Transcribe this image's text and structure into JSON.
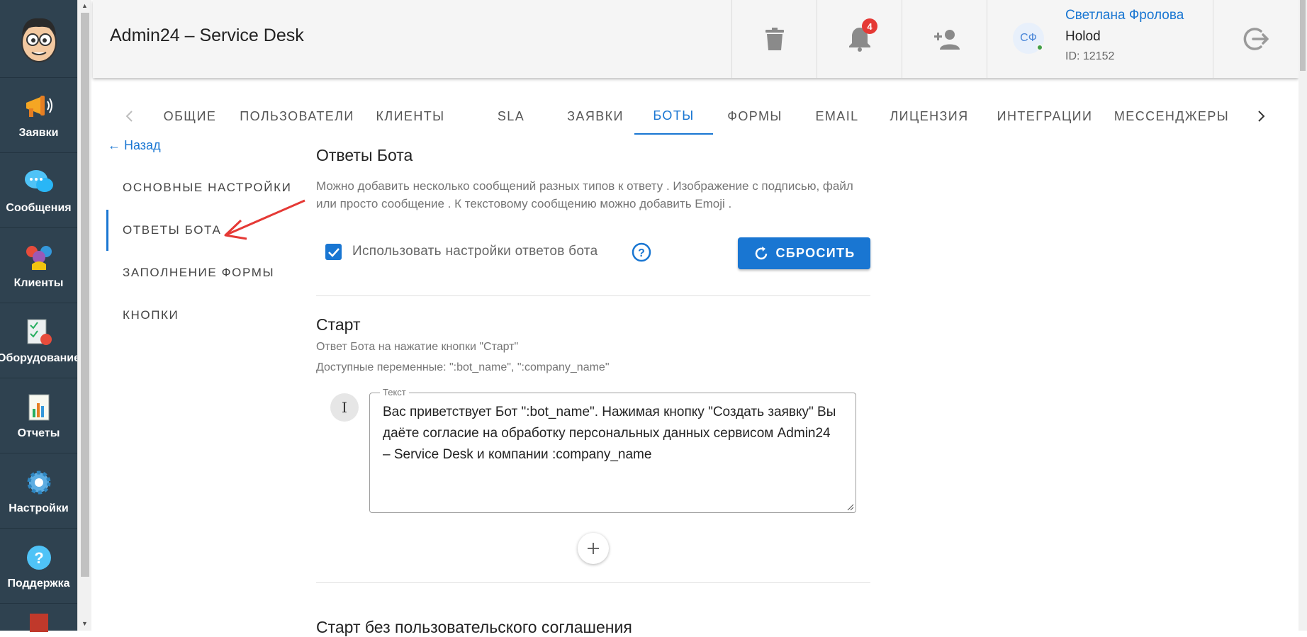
{
  "app": {
    "title": "Admin24 – Service Desk"
  },
  "sidebar": {
    "items": [
      {
        "label": "Заявки",
        "icon": "megaphone-icon"
      },
      {
        "label": "Сообщения",
        "icon": "chat-bubbles-icon"
      },
      {
        "label": "Клиенты",
        "icon": "people-icon"
      },
      {
        "label": "Оборудование",
        "icon": "equipment-checklist-icon"
      },
      {
        "label": "Отчеты",
        "icon": "report-chart-icon"
      },
      {
        "label": "Настройки",
        "icon": "gear-icon"
      },
      {
        "label": "Поддержка",
        "icon": "question-icon"
      }
    ]
  },
  "header": {
    "notifications_count": "4",
    "user": {
      "initials": "СФ",
      "name": "Светлана Фролова",
      "org": "Holod",
      "id": "ID: 12152"
    }
  },
  "tabs": [
    "ОБЩИЕ",
    "ПОЛЬЗОВАТЕЛИ",
    "КЛИЕНТЫ",
    "SLA",
    "ЗАЯВКИ",
    "БОТЫ",
    "ФОРМЫ",
    "EMAIL",
    "ЛИЦЕНЗИЯ",
    "ИНТЕГРАЦИИ",
    "МЕССЕНДЖЕРЫ"
  ],
  "active_tab": "БОТЫ",
  "subnav": {
    "back_label": "← Назад",
    "items": [
      "ОСНОВНЫЕ НАСТРОЙКИ",
      "ОТВЕТЫ БОТА",
      "ЗАПОЛНЕНИЕ ФОРМЫ",
      "КНОПКИ"
    ],
    "active": "ОТВЕТЫ БОТА"
  },
  "content": {
    "title": "Ответы Бота",
    "description": "Можно добавить несколько сообщений разных типов к ответу . Изображение с подписью, файл или просто сообщение . К текстовому сообщению можно добавить Emoji .",
    "checkbox_label": "Использовать настройки ответов бота",
    "checkbox_checked": true,
    "reset_label": "СБРОСИТЬ",
    "start": {
      "title": "Старт",
      "hint": "Ответ Бота на нажатие кнопки \"Старт\"",
      "variables": "Доступные переменные: \":bot_name\", \":company_name\"",
      "message_type": "I",
      "field_label": "Текст",
      "field_value": "Вас приветствует Бот \":bot_name\". Нажимая кнопку \"Создать заявку\" Вы даёте согласие на обработку персональных данных сервисом Admin24 – Service Desk и компании :company_name"
    },
    "next_section_title": "Старт без пользовательского соглашения"
  }
}
